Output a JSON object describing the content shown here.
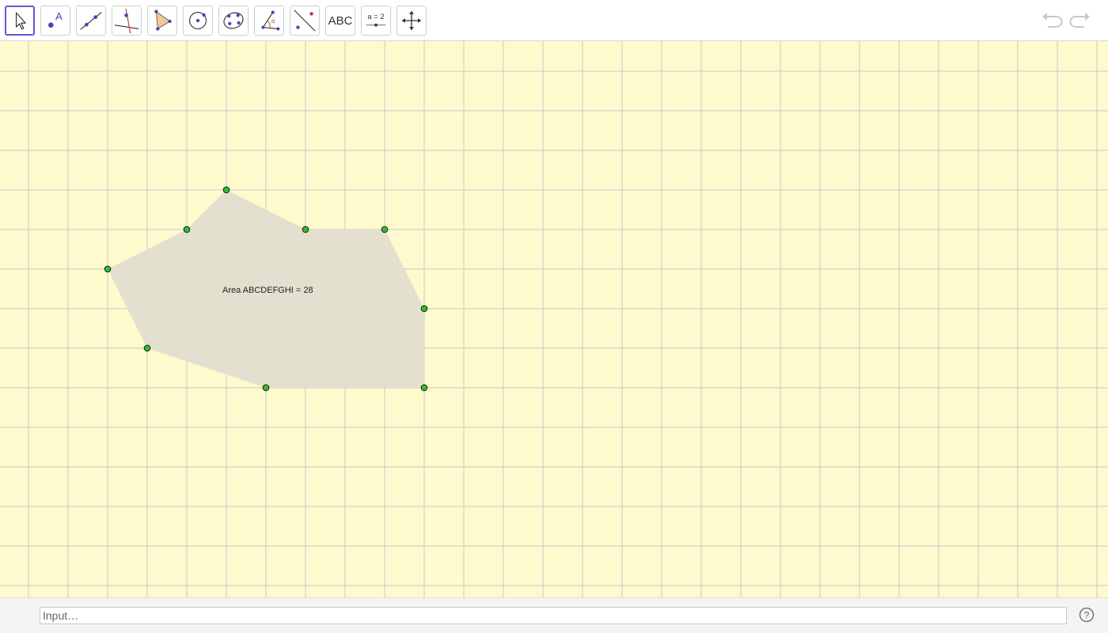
{
  "toolbar": {
    "tools": [
      {
        "name": "move-tool",
        "icon": "arrow-cursor-icon",
        "active": true
      },
      {
        "name": "point-tool",
        "icon": "point-icon",
        "label": "A"
      },
      {
        "name": "line-tool",
        "icon": "line-through-points-icon"
      },
      {
        "name": "perpendicular-tool",
        "icon": "perpendicular-line-icon"
      },
      {
        "name": "polygon-tool",
        "icon": "polygon-icon"
      },
      {
        "name": "circle-tool",
        "icon": "circle-center-point-icon"
      },
      {
        "name": "conic-tool",
        "icon": "conic-five-points-icon"
      },
      {
        "name": "angle-tool",
        "icon": "angle-icon",
        "label": "α"
      },
      {
        "name": "reflect-tool",
        "icon": "reflect-about-line-icon"
      },
      {
        "name": "text-tool",
        "icon": "text-icon",
        "label": "ABC"
      },
      {
        "name": "slider-tool",
        "icon": "slider-icon",
        "label": "a = 2"
      },
      {
        "name": "move-graphics-tool",
        "icon": "move-graphics-view-icon"
      }
    ],
    "undo_icon": "undo-icon",
    "redo_icon": "redo-icon"
  },
  "graphics": {
    "background": "#fffacd",
    "grid_color": "#c8c8c8",
    "polygon_fill": "#e3e0cf",
    "point_color": "#2fbf2f",
    "area_label": "Area ABCDEFGHI = 28"
  },
  "input_bar": {
    "placeholder": "Input…",
    "help_icon": "help-icon"
  }
}
